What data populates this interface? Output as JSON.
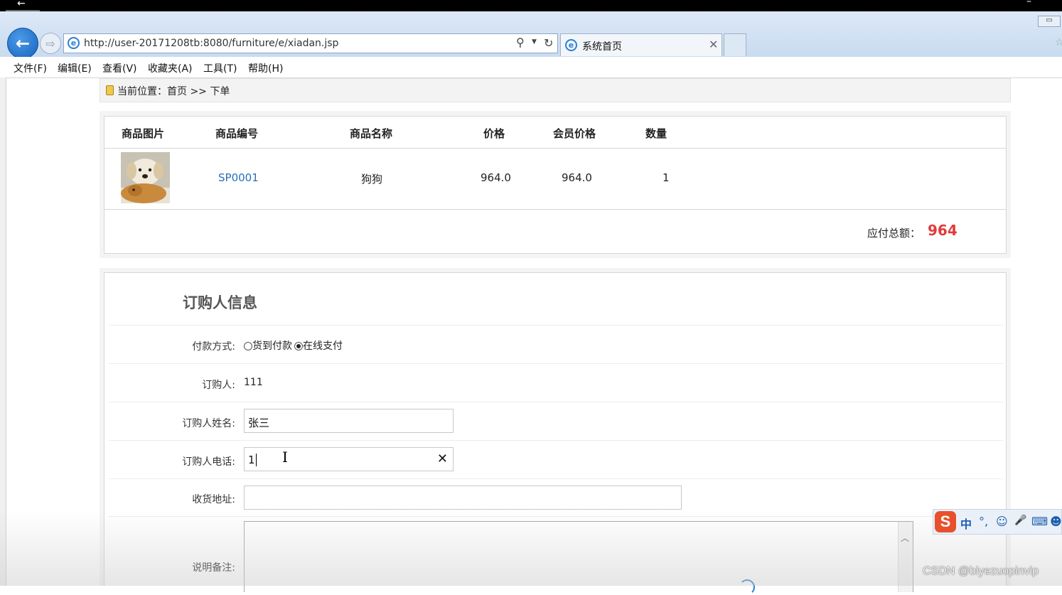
{
  "browser": {
    "url": "http://user-20171208tb:8080/furniture/e/xiadan.jsp",
    "tab_title": "系统首页",
    "menu": [
      "文件(F)",
      "编辑(E)",
      "查看(V)",
      "收藏夹(A)",
      "工具(T)",
      "帮助(H)"
    ]
  },
  "breadcrumb": {
    "text": "当前位置：首页 >> 下单"
  },
  "order_table": {
    "headers": [
      "商品图片",
      "商品编号",
      "商品名称",
      "价格",
      "会员价格",
      "数量"
    ],
    "rows": [
      {
        "sku": "SP0001",
        "name": "狗狗",
        "price": "964.0",
        "member_price": "964.0",
        "qty": "1"
      }
    ],
    "total_label": "应付总额：",
    "total_value": "964"
  },
  "buyer_form": {
    "title": "订购人信息",
    "payment_label": "付款方式:",
    "payment_options": [
      "货到付款",
      "在线支付"
    ],
    "payment_selected": "在线支付",
    "buyer_label": "订购人:",
    "buyer_value": "111",
    "name_label": "订购人姓名:",
    "name_value": "张三",
    "phone_label": "订购人电话:",
    "phone_value": "1",
    "address_label": "收货地址:",
    "address_value": "",
    "remark_label": "说明备注:"
  },
  "ime": {
    "items": [
      "中",
      "°,",
      "☺",
      "🎤",
      "⌨"
    ]
  },
  "watermark": "CSDN @biyezuopinvip",
  "colors": {
    "accent_red": "#e03b3b",
    "link_blue": "#2a6fb8"
  }
}
